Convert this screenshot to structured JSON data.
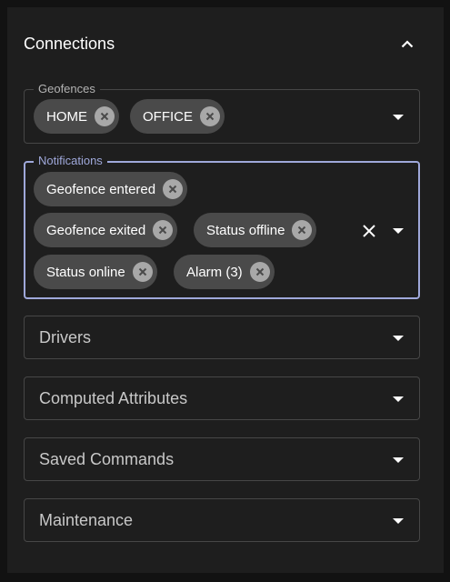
{
  "section": {
    "title": "Connections"
  },
  "geofences": {
    "label": "Geofences",
    "chips": [
      "HOME",
      "OFFICE"
    ]
  },
  "notifications": {
    "label": "Notifications",
    "chips": [
      "Geofence entered",
      "Geofence exited",
      "Status offline",
      "Status online",
      "Alarm (3)"
    ]
  },
  "selects": {
    "drivers": "Drivers",
    "computed_attributes": "Computed Attributes",
    "saved_commands": "Saved Commands",
    "maintenance": "Maintenance"
  },
  "colors": {
    "background": "#1e1e1e",
    "chip": "#4a4a4a",
    "focus_accent": "#9fa8da",
    "border": "#474747"
  }
}
